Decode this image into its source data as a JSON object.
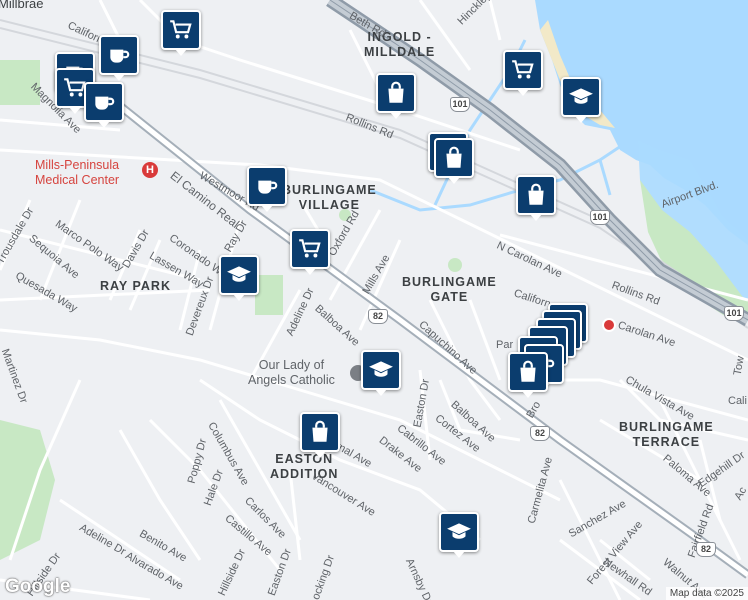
{
  "areas": {
    "millbrae": "Millbrae",
    "ingold_milldale_1": "INGOLD -",
    "ingold_milldale_2": "MILLDALE",
    "burlingame_village_1": "BURLINGAME",
    "burlingame_village_2": "VILLAGE",
    "ray_park": "RAY PARK",
    "burlingame_gate_1": "BURLINGAME",
    "burlingame_gate_2": "GATE",
    "burlingame_terrace_1": "BURLINGAME",
    "burlingame_terrace_2": "TERRACE",
    "easton_addition_1": "EASTON",
    "easton_addition_2": "ADDITION"
  },
  "streets": {
    "california_1": "Californ",
    "magnolia": "Magnolia Ave",
    "rollins_1": "Rollins Rd",
    "rollins_2": "Rollins Rd",
    "el_camino": "El Camino Real",
    "westmoor": "Westmoor Rd",
    "trousdale": "Trousdale Dr",
    "sequoia": "Sequoia Ave",
    "marco_polo": "Marco Polo Way",
    "quesada": "Quesada Way",
    "davis": "Davis Dr",
    "lassen": "Lassen Way",
    "coronado": "Coronado Way",
    "ray_dr": "Ray Dr",
    "devereux": "Devereux Dr",
    "adeline_1": "Adeline Dr",
    "oxford": "Oxford Rd",
    "mills": "Mills Ave",
    "balboa_1": "Balboa Ave",
    "capuchino": "Capuchino Ave",
    "n_carolan": "N Carolan Ave",
    "california_2": "Californ",
    "carolan": "Carolan Ave",
    "airport": "Airport Blvd.",
    "easton_1": "Easton Dr",
    "balboa_2": "Balboa Ave",
    "cortez": "Cortez Ave",
    "cabrillo": "Cabrillo Ave",
    "drake": "Drake Ave",
    "vancouver": "Vancouver Ave",
    "bernal": "rnal Ave",
    "columbus": "Columbus Ave",
    "poppy": "Poppy Dr",
    "hale": "Hale Dr",
    "carlos": "Carlos Ave",
    "castillo": "Castillo Ave",
    "benito": "Benito Ave",
    "alvarado": "Alvarado Ave",
    "adeline_2": "Adeline Dr",
    "hillside_1": "Hillside Dr",
    "hillside_2": "Hillside Dr",
    "easton_2": "Easton Dr",
    "ocking": "ocking Dr",
    "arnsby": "Arnsby Dr",
    "martinez": "Martinez Dr",
    "chula_vista": "Chula Vista Ave",
    "paloma": "Paloma Ave",
    "edgehill": "Edgehill Dr",
    "fairfield": "Fairfield Rd",
    "sanchez": "Sanchez Ave",
    "forest_view": "Forest View Ave",
    "newhall": "Newhall Rd",
    "walnut": "Walnut Ave",
    "carmelita": "Carmelita Ave",
    "bro": "Bro",
    "par": "Par",
    "cali": "Cali",
    "tow": "Tow",
    "beth": "Beth Rd",
    "hinckley": "Hinckley",
    "ac": "Ac"
  },
  "shields": {
    "us101": "101",
    "ca82": "82"
  },
  "pois": {
    "hospital_1": "Mills-Peninsula",
    "hospital_2": "Medical Center",
    "hospital_icon": "H",
    "church_1": "Our Lady of",
    "church_2": "Angels Catholic"
  },
  "icons": {
    "grocery": "shopping-cart",
    "cafe": "coffee-cup",
    "shopping": "shopping-bag",
    "school": "graduation-cap"
  },
  "colors": {
    "water": "#aadaff",
    "park": "#c8e8c4",
    "freeway": "#8f9ba8",
    "street": "#ffffff",
    "marker": "#0b3d6e"
  },
  "attribution": {
    "logo": "Google",
    "credit": "Map data ©2025"
  }
}
